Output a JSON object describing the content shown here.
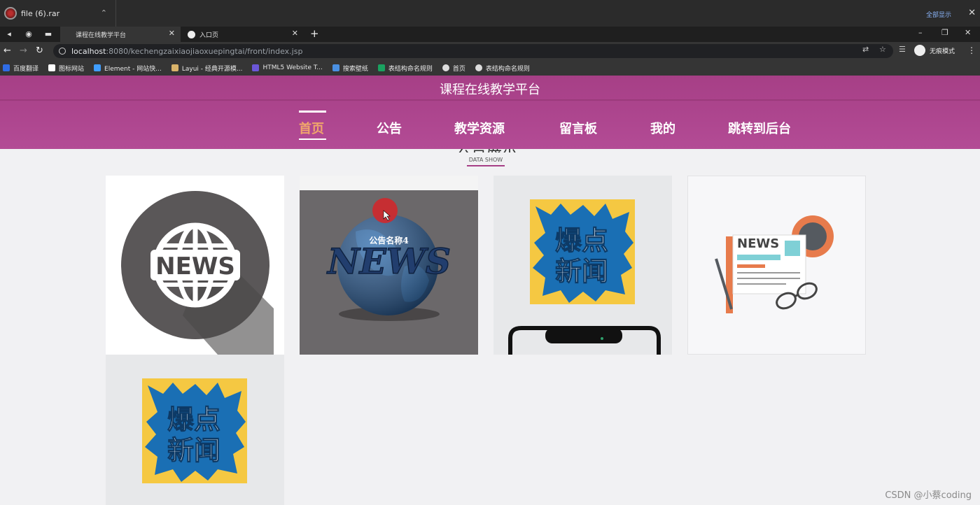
{
  "download_bar": {
    "file_name": "file (6).rar",
    "show_all": "全部显示",
    "close": "✕"
  },
  "tabs": [
    {
      "label": "课程在线教学平台",
      "active": true
    },
    {
      "label": "入口页",
      "active": false
    }
  ],
  "address_bar": {
    "url_host": "localhost",
    "url_rest": ":8080/kechengzaixiaojiaoxuepingtai/front/index.jsp",
    "profile_label": "无痕模式"
  },
  "bookmarks": [
    {
      "label": "百度翻译",
      "color": "#2f6ce5"
    },
    {
      "label": "图标网站",
      "color": "#ffffff"
    },
    {
      "label": "Element - 网站快...",
      "color": "#409eff"
    },
    {
      "label": "Layui - 经典开源模...",
      "color": "#d9b36a"
    },
    {
      "label": "HTML5 Website T...",
      "color": "#6b57d8"
    },
    {
      "label": "搜索壁纸",
      "color": "#4a90e2"
    },
    {
      "label": "表结构命名规则",
      "color": "#1aa260"
    },
    {
      "label": "首页",
      "color": "#dddddd"
    },
    {
      "label": "表结构命名规则",
      "color": "#dddddd"
    }
  ],
  "site": {
    "title": "课程在线教学平台",
    "nav": [
      "首页",
      "公告",
      "教学资源",
      "留言板",
      "我的",
      "跳转到后台"
    ],
    "active_nav": "首页",
    "brand_color": "#a63f86"
  },
  "section": {
    "title": "公告展示",
    "subtitle": "DATA SHOW"
  },
  "cards": [
    {
      "image": "news-globe-icon",
      "caption": ""
    },
    {
      "image": "news-3d-globe",
      "caption": "公告名称4"
    },
    {
      "image": "breaking-news-phone",
      "caption": ""
    },
    {
      "image": "newspaper-illustration",
      "caption": ""
    },
    {
      "image": "breaking-news-phone",
      "caption": ""
    }
  ],
  "breaking_news_text": {
    "line1": "爆点",
    "line2": "新闻"
  },
  "news_word": "NEWS",
  "watermark": "CSDN @小蔡coding"
}
